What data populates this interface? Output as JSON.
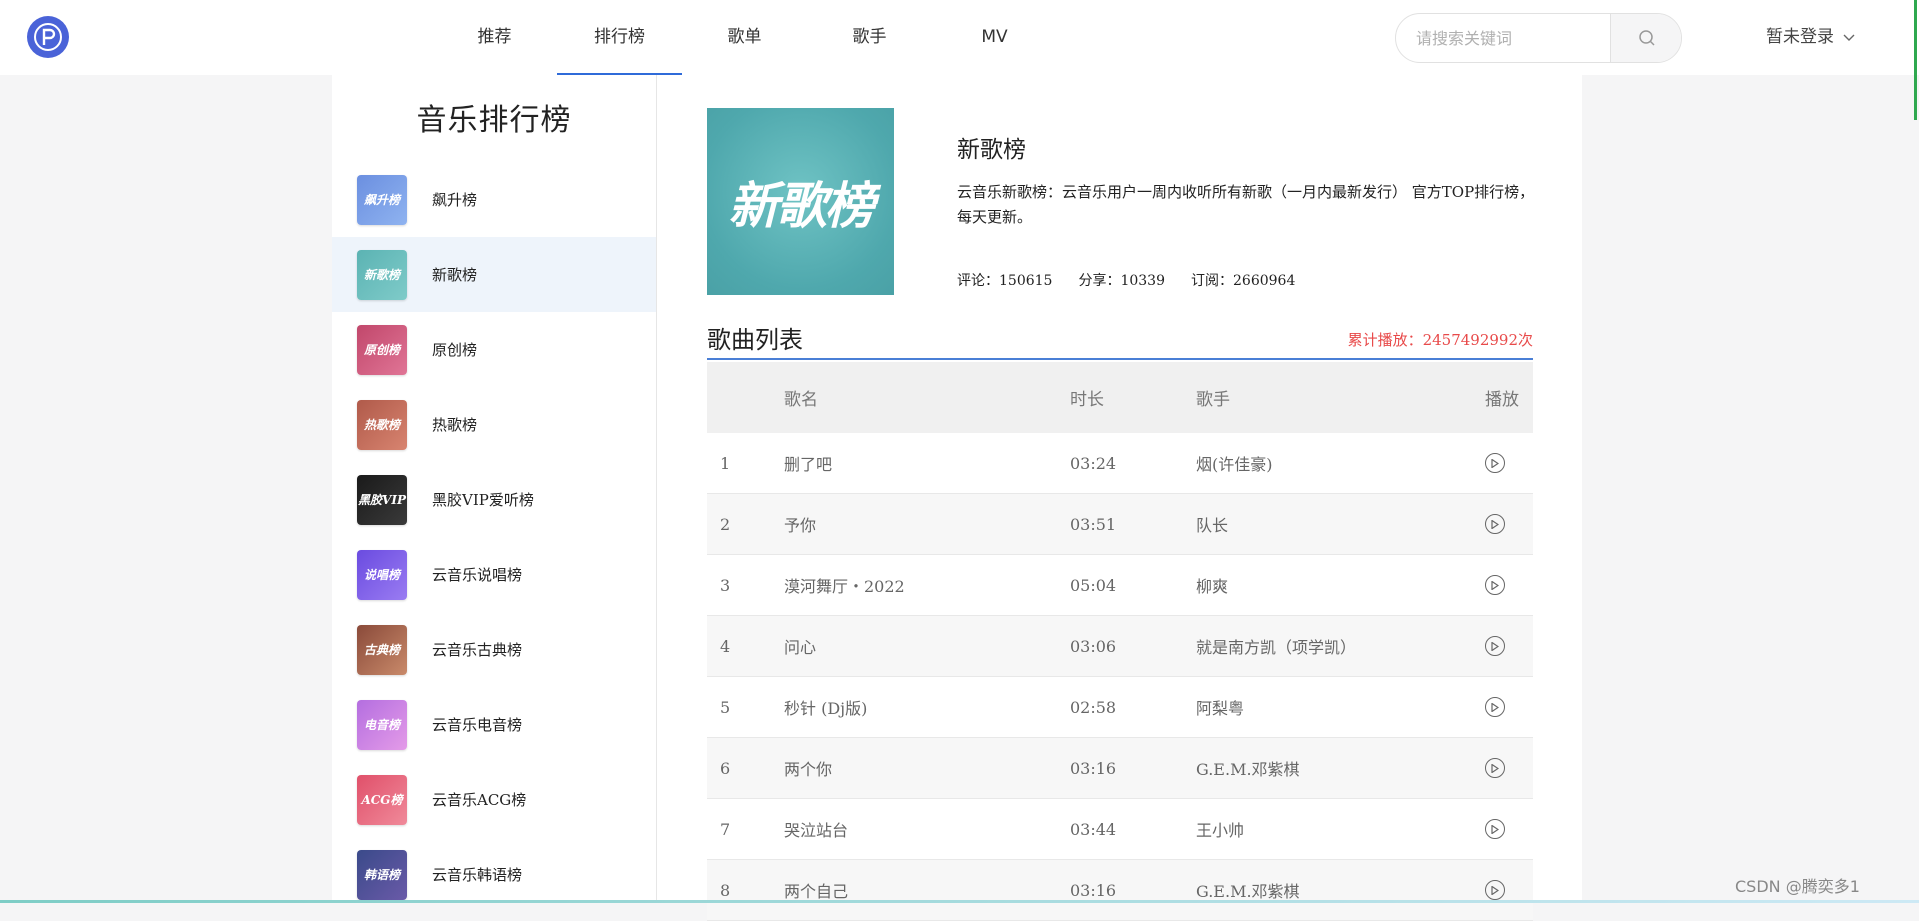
{
  "header": {
    "logo_text": "P",
    "nav": [
      {
        "label": "推荐",
        "active": false
      },
      {
        "label": "排行榜",
        "active": true
      },
      {
        "label": "歌单",
        "active": false
      },
      {
        "label": "歌手",
        "active": false
      },
      {
        "label": "MV",
        "active": false
      }
    ],
    "search_placeholder": "请搜索关键词",
    "login_label": "暂未登录"
  },
  "sidebar": {
    "title": "音乐排行榜",
    "items": [
      {
        "label": "飙升榜",
        "thumb_text": "飙升榜",
        "color1": "#6b8fe0",
        "color2": "#8fb3f0",
        "active": false
      },
      {
        "label": "新歌榜",
        "thumb_text": "新歌榜",
        "color1": "#5bb3b3",
        "color2": "#7fcbc9",
        "active": true
      },
      {
        "label": "原创榜",
        "thumb_text": "原创榜",
        "color1": "#c1476b",
        "color2": "#e07596",
        "active": false
      },
      {
        "label": "热歌榜",
        "thumb_text": "热歌榜",
        "color1": "#b05a4a",
        "color2": "#d88470",
        "active": false
      },
      {
        "label": "黑胶VIP爱听榜",
        "thumb_text": "黑胶VIP",
        "color1": "#1a1a1a",
        "color2": "#3a3a3a",
        "active": false
      },
      {
        "label": "云音乐说唱榜",
        "thumb_text": "说唱榜",
        "color1": "#6a4be0",
        "color2": "#9a7cf2",
        "active": false
      },
      {
        "label": "云音乐古典榜",
        "thumb_text": "古典榜",
        "color1": "#8a4a3a",
        "color2": "#c98a6a",
        "active": false
      },
      {
        "label": "云音乐电音榜",
        "thumb_text": "电音榜",
        "color1": "#b46ee0",
        "color2": "#e49be8",
        "active": false
      },
      {
        "label": "云音乐ACG榜",
        "thumb_text": "ACG榜",
        "color1": "#e0506a",
        "color2": "#f08a9a",
        "active": false
      },
      {
        "label": "云音乐韩语榜",
        "thumb_text": "韩语榜",
        "color1": "#3a4a8a",
        "color2": "#6a5aa8",
        "active": false
      }
    ]
  },
  "board": {
    "cover_text": "新歌榜",
    "title": "新歌榜",
    "description": "云音乐新歌榜：云音乐用户一周内收听所有新歌（一月内最新发行） 官方TOP排行榜，每天更新。",
    "comments": "评论：150615",
    "shares": "分享：10339",
    "subscriptions": "订阅：2660964"
  },
  "song_list": {
    "title": "歌曲列表",
    "play_total": "累计播放：2457492992次",
    "columns": {
      "name": "歌名",
      "duration": "时长",
      "artist": "歌手",
      "play": "播放"
    },
    "rows": [
      {
        "idx": "1",
        "name": "删了吧",
        "duration": "03:24",
        "artist": "烟(许佳豪)"
      },
      {
        "idx": "2",
        "name": "予你",
        "duration": "03:51",
        "artist": "队长"
      },
      {
        "idx": "3",
        "name": "漠河舞厅・2022",
        "duration": "05:04",
        "artist": "柳爽"
      },
      {
        "idx": "4",
        "name": "问心",
        "duration": "03:06",
        "artist": "就是南方凯（项学凯）"
      },
      {
        "idx": "5",
        "name": "秒针 (Dj版)",
        "duration": "02:58",
        "artist": "阿梨粤"
      },
      {
        "idx": "6",
        "name": "两个你",
        "duration": "03:16",
        "artist": "G.E.M.邓紫棋"
      },
      {
        "idx": "7",
        "name": "哭泣站台",
        "duration": "03:44",
        "artist": "王小帅"
      },
      {
        "idx": "8",
        "name": "两个自己",
        "duration": "03:16",
        "artist": "G.E.M.邓紫棋"
      }
    ]
  },
  "watermark": "CSDN @腾奕多1"
}
